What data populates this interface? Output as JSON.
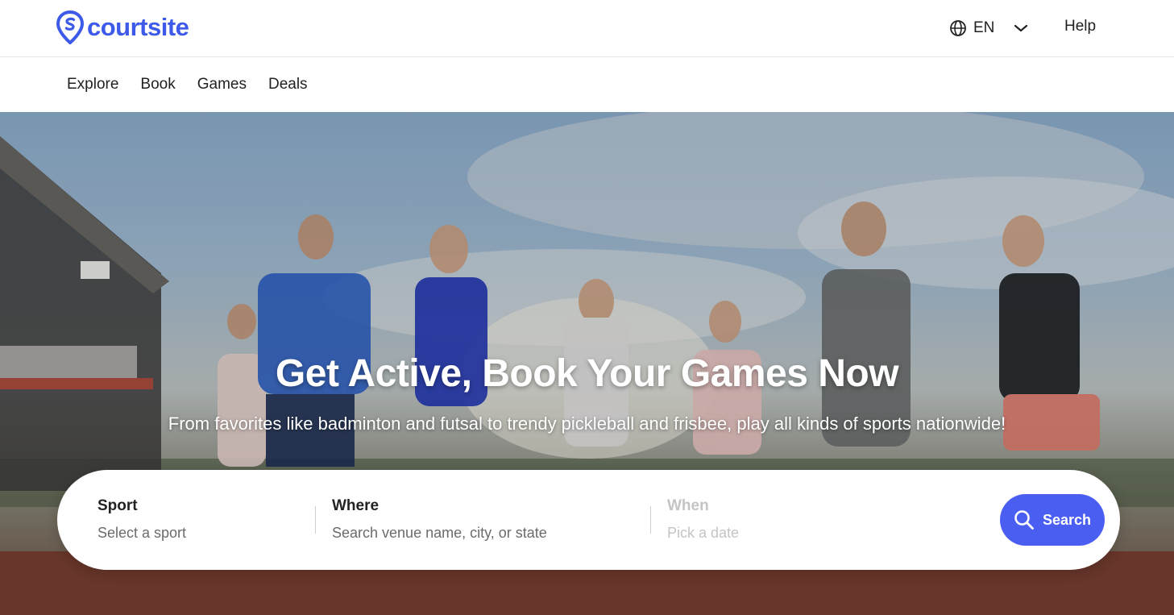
{
  "header": {
    "logo_text": "courtsite",
    "language": "EN",
    "help_label": "Help"
  },
  "nav": {
    "items": [
      {
        "label": "Explore"
      },
      {
        "label": "Book"
      },
      {
        "label": "Games"
      },
      {
        "label": "Deals"
      }
    ]
  },
  "hero": {
    "title": "Get Active, Book Your Games Now",
    "subtitle": "From favorites like badminton and futsal to trendy pickleball and frisbee, play all kinds of sports nationwide!"
  },
  "search": {
    "sport_label": "Sport",
    "sport_placeholder": "Select a sport",
    "where_label": "Where",
    "where_placeholder": "Search venue name, city, or state",
    "when_label": "When",
    "when_placeholder": "Pick a date",
    "button_label": "Search"
  },
  "colors": {
    "brand": "#3d5be8",
    "search_button": "#4a5ef2"
  }
}
